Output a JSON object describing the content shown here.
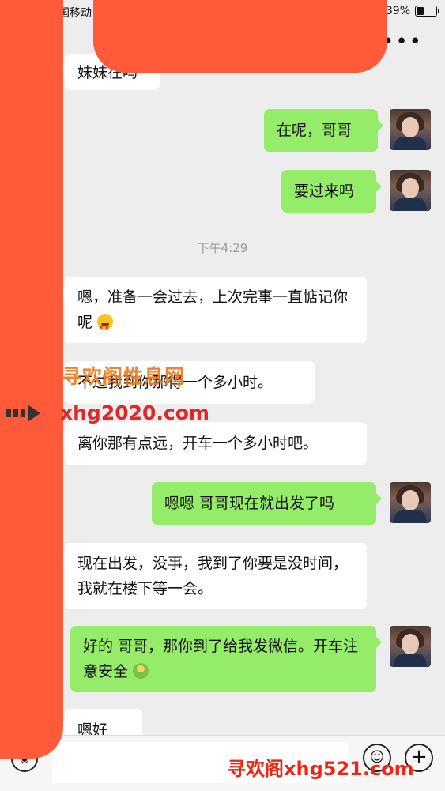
{
  "status_bar": {
    "carrier": "中国移动",
    "battery": "39%",
    "battery_level": 0.39
  },
  "nav": {
    "more_label": "•••"
  },
  "chat": {
    "timestamp": "下午4:29",
    "messages": [
      {
        "side": "in",
        "text": "妹妹在吗"
      },
      {
        "side": "out",
        "text": "在呢，哥哥"
      },
      {
        "side": "out",
        "text": "要过来吗"
      },
      {
        "side": "in",
        "text": "嗯，准备一会过去，上次完事一直惦记你呢",
        "emoji": "star-struck-emoji"
      },
      {
        "side": "in",
        "text": "不过我到你那得一个多小时。"
      },
      {
        "side": "in",
        "text": "离你那有点远，开车一个多小时吧。"
      },
      {
        "side": "out",
        "text": "嗯嗯  哥哥现在就出发了吗"
      },
      {
        "side": "in",
        "text": "现在出发，没事，我到了你要是没时间，我就在楼下等一会。"
      },
      {
        "side": "out",
        "text": "好的 哥哥，那你到了给我发微信。开车注意安全",
        "emoji": "pray-emoji"
      },
      {
        "side": "in",
        "text": "嗯好"
      }
    ]
  },
  "watermarks": {
    "line1": "寻欢阁性息网",
    "line2": "xhg2020.com",
    "line3": "寻欢阁xhg521.com"
  },
  "input_bar": {
    "voice_icon": "voice-icon",
    "emoji_icon": "emoji-icon",
    "plus_icon": "plus-icon"
  },
  "colors": {
    "background": "#ededed",
    "outgoing_bubble": "#95ec69",
    "incoming_bubble": "#ffffff",
    "redaction": "#ff5a3a"
  }
}
